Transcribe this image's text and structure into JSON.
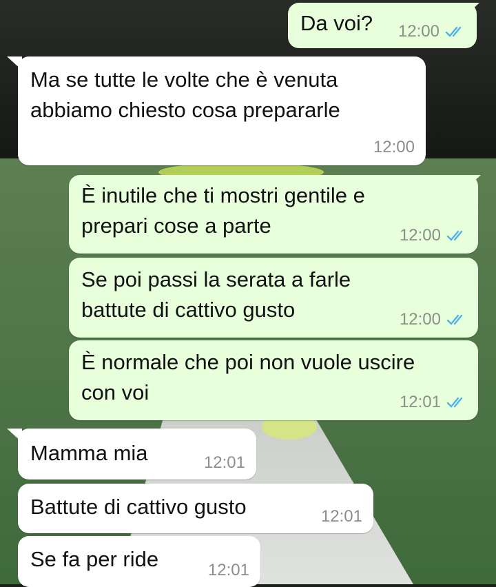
{
  "colors": {
    "outgoing_bubble": "#e7ffdb",
    "incoming_bubble": "#ffffff",
    "read_ticks": "#4fb1e8",
    "time_text": "#8a8f8a"
  },
  "messages": [
    {
      "direction": "outgoing",
      "text": "Da voi?",
      "time": "12:00",
      "status": "read-double-check-icon"
    },
    {
      "direction": "incoming",
      "text": "Ma se tutte le volte che è venuta\nabbiamo chiesto cosa prepararle",
      "time": "12:00"
    },
    {
      "direction": "outgoing",
      "text": "È inutile che ti mostri gentile e\nprepari cose a parte",
      "time": "12:00",
      "status": "read-double-check-icon"
    },
    {
      "direction": "outgoing",
      "text": "Se poi passi la serata a farle\nbattute di cattivo gusto",
      "time": "12:00",
      "status": "read-double-check-icon"
    },
    {
      "direction": "outgoing",
      "text": "È normale che poi non vuole uscire\ncon voi",
      "time": "12:01",
      "status": "read-double-check-icon"
    },
    {
      "direction": "incoming",
      "text": "Mamma mia",
      "time": "12:01"
    },
    {
      "direction": "incoming",
      "text": "Battute di cattivo gusto",
      "time": "12:01"
    },
    {
      "direction": "incoming",
      "text": "Se fa per ride",
      "time": "12:01"
    }
  ]
}
